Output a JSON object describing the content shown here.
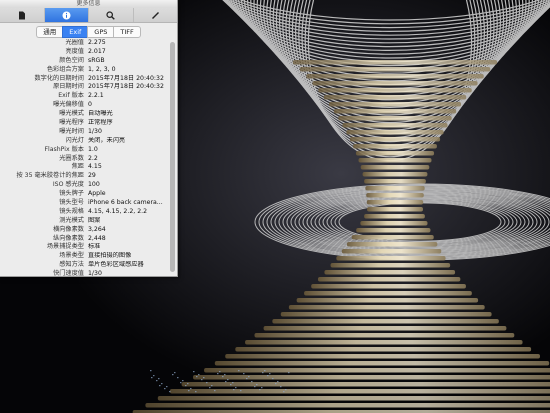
{
  "window": {
    "title": "更多信息"
  },
  "toolbar": {
    "tools": [
      {
        "icon": "document-icon"
      },
      {
        "icon": "info-icon"
      },
      {
        "icon": "search-icon"
      },
      {
        "icon": "pencil-icon"
      }
    ]
  },
  "tabs": [
    {
      "label": "通用"
    },
    {
      "label": "Exif"
    },
    {
      "label": "GPS"
    },
    {
      "label": "TIFF"
    }
  ],
  "exif": [
    {
      "key": "光圈值",
      "value": "2.275"
    },
    {
      "key": "亮度值",
      "value": "2.017"
    },
    {
      "key": "颜色空间",
      "value": "sRGB"
    },
    {
      "key": "色彩组合方案",
      "value": "1, 2, 3, 0"
    },
    {
      "key": "数字化的日期时间",
      "value": "2015年7月18日 20:40:32"
    },
    {
      "key": "原日期时间",
      "value": "2015年7月18日 20:40:32"
    },
    {
      "key": "Exif 版本",
      "value": "2.2.1"
    },
    {
      "key": "曝光偏移值",
      "value": "0"
    },
    {
      "key": "曝光模式",
      "value": "自动曝光"
    },
    {
      "key": "曝光程序",
      "value": "正常程序"
    },
    {
      "key": "曝光时间",
      "value": "1/30"
    },
    {
      "key": "闪光灯",
      "value": "关闭，未闪亮"
    },
    {
      "key": "FlashPix 版本",
      "value": "1.0"
    },
    {
      "key": "光圈系数",
      "value": "2.2"
    },
    {
      "key": "焦距",
      "value": "4.15"
    },
    {
      "key": "按 35 毫米胶卷计的焦距",
      "value": "29"
    },
    {
      "key": "ISO 感光度",
      "value": "100"
    },
    {
      "key": "镜头牌子",
      "value": "Apple"
    },
    {
      "key": "镜头型号",
      "value": "iPhone 6 back camera..."
    },
    {
      "key": "镜头规格",
      "value": "4.15, 4.15, 2.2, 2.2"
    },
    {
      "key": "测光模式",
      "value": "图案"
    },
    {
      "key": "横向像素数",
      "value": "3,264"
    },
    {
      "key": "纵向像素数",
      "value": "2,448"
    },
    {
      "key": "场景捕捉类型",
      "value": "标准"
    },
    {
      "key": "场景类型",
      "value": "直接拍摄的图像"
    },
    {
      "key": "感知方法",
      "value": "单片色彩区域感应器"
    },
    {
      "key": "快门速度值",
      "value": "1/30"
    }
  ],
  "colors": {
    "accent": "#3a82f2",
    "panel": "#ececec"
  }
}
